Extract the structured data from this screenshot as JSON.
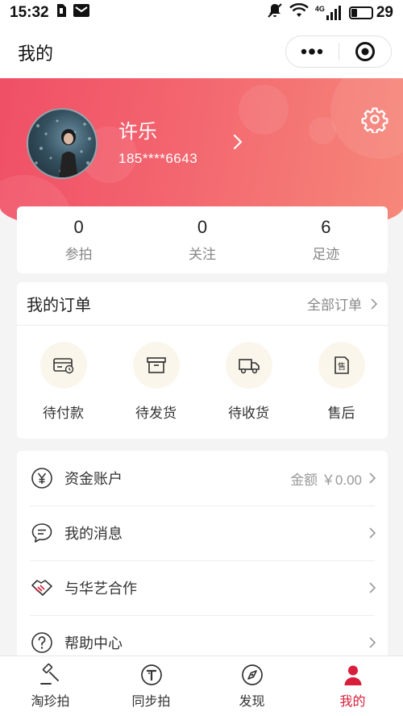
{
  "status_bar": {
    "time": "15:32",
    "battery": "29",
    "battery_level": 0.29,
    "network": "4G"
  },
  "nav": {
    "title": "我的"
  },
  "profile": {
    "name": "许乐",
    "phone": "185****6643"
  },
  "stats": [
    {
      "value": "0",
      "label": "参拍"
    },
    {
      "value": "0",
      "label": "关注"
    },
    {
      "value": "6",
      "label": "足迹"
    }
  ],
  "orders": {
    "title": "我的订单",
    "all_label": "全部订单",
    "items": [
      {
        "label": "待付款",
        "icon": "card-clock-icon"
      },
      {
        "label": "待发货",
        "icon": "box-icon"
      },
      {
        "label": "待收货",
        "icon": "truck-icon"
      },
      {
        "label": "售后",
        "icon": "after-sale-icon"
      }
    ]
  },
  "menu": [
    {
      "label": "资金账户",
      "icon": "yen-circle-icon",
      "right_text": "金额 ￥0.00"
    },
    {
      "label": "我的消息",
      "icon": "chat-bubble-icon"
    },
    {
      "label": "与华艺合作",
      "icon": "handshake-icon"
    },
    {
      "label": "帮助中心",
      "icon": "help-circle-icon"
    }
  ],
  "tabs": [
    {
      "label": "淘珍拍",
      "icon": "gavel-icon",
      "active": false
    },
    {
      "label": "同步拍",
      "icon": "t-circle-icon",
      "active": false
    },
    {
      "label": "发现",
      "icon": "compass-icon",
      "active": false
    },
    {
      "label": "我的",
      "icon": "person-icon",
      "active": true
    }
  ],
  "colors": {
    "accent": "#d81e3a",
    "hero_start": "#f04f66",
    "hero_end": "#f6887a"
  }
}
